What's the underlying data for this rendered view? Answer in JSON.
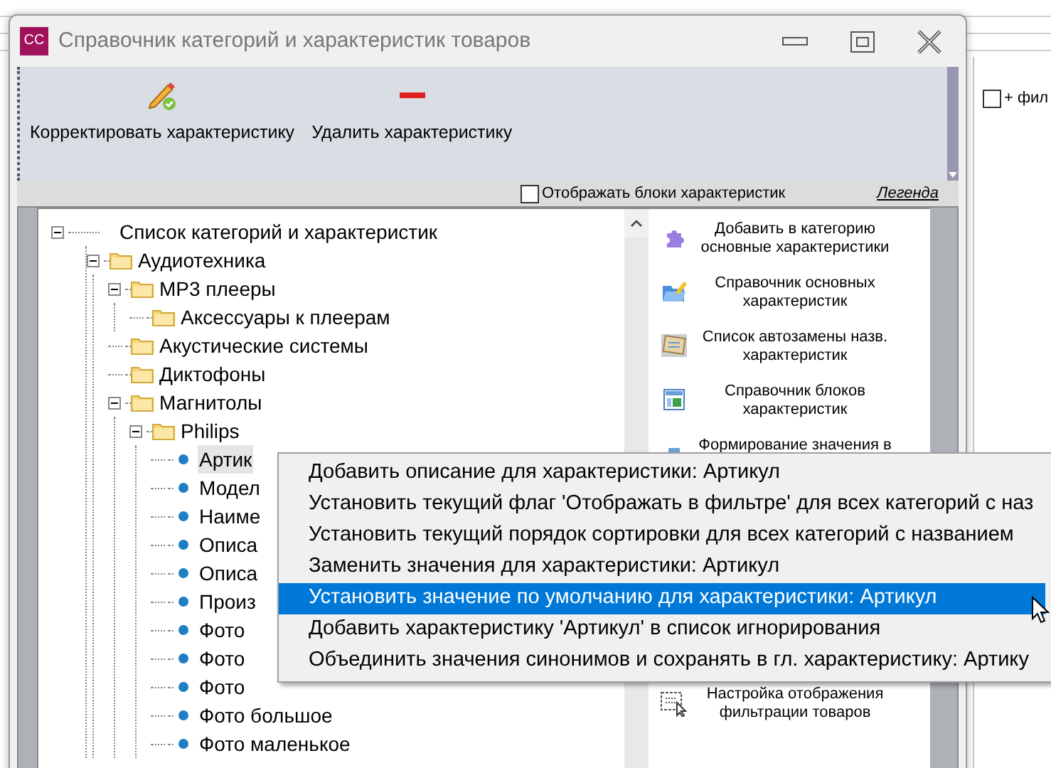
{
  "window": {
    "title": "Справочник категорий и характеристик товаров",
    "logo": "CC"
  },
  "toolbar": [
    {
      "label": "Корректировать характеристику",
      "kind": "edit"
    },
    {
      "label": "Удалить характеристику",
      "kind": "delete"
    }
  ],
  "show_blocks": {
    "label": "Отображать блоки характеристик",
    "checked": false
  },
  "legend_link": "Легенда",
  "tree": {
    "label": "Список категорий и характеристик",
    "kind": "root",
    "expanded": true,
    "selected": false,
    "children": [
      {
        "label": "Аудиотехника",
        "kind": "folder",
        "expanded": true,
        "selected": false,
        "children": [
          {
            "label": "MP3 плееры",
            "kind": "folder",
            "expanded": true,
            "selected": false,
            "children": [
              {
                "label": "Аксессуары к плеерам",
                "kind": "folder",
                "selected": false
              }
            ]
          },
          {
            "label": "Акустические системы",
            "kind": "folder",
            "selected": false
          },
          {
            "label": "Диктофоны",
            "kind": "folder",
            "selected": false
          },
          {
            "label": "Магнитолы",
            "kind": "folder",
            "expanded": true,
            "selected": false,
            "children": [
              {
                "label": "Philips",
                "kind": "folder",
                "expanded": true,
                "selected": false,
                "children": [
                  {
                    "label": "Артик",
                    "kind": "property",
                    "selected": true
                  },
                  {
                    "label": "Модел",
                    "kind": "property",
                    "selected": false
                  },
                  {
                    "label": "Наиме",
                    "kind": "property",
                    "selected": false
                  },
                  {
                    "label": "Описа",
                    "kind": "property",
                    "selected": false
                  },
                  {
                    "label": "Описа",
                    "kind": "property",
                    "selected": false
                  },
                  {
                    "label": "Произ",
                    "kind": "property",
                    "selected": false
                  },
                  {
                    "label": "Фото",
                    "kind": "property",
                    "selected": false
                  },
                  {
                    "label": "Фото",
                    "kind": "property",
                    "selected": false
                  },
                  {
                    "label": "Фото",
                    "kind": "property",
                    "selected": false
                  },
                  {
                    "label": "Фото большое",
                    "kind": "property",
                    "selected": false
                  },
                  {
                    "label": "Фото маленькое",
                    "kind": "property",
                    "selected": false
                  }
                ]
              }
            ]
          }
        ]
      }
    ]
  },
  "actions": [
    {
      "label": "Добавить в категорию основные характеристики",
      "kind": "puzzle"
    },
    {
      "label": "Справочник основных характеристик",
      "kind": "folder-edit"
    },
    {
      "label": "Список автозамены назв. характеристик",
      "kind": "notepad"
    },
    {
      "label": "Справочник блоков характеристик",
      "kind": "blocks"
    },
    {
      "label": "Формирование значения в",
      "kind": "form"
    },
    {
      "label": "Настройка отображения фильтрации товаров",
      "kind": "filter"
    }
  ],
  "context_menu": [
    {
      "label": "Добавить описание для характеристики: Артикул",
      "selected": false
    },
    {
      "label": "Установить текущий флаг 'Отображать в фильтре' для всех категорий с наз",
      "selected": false
    },
    {
      "label": "Установить текущий порядок сортировки для всех категорий с названием",
      "selected": false
    },
    {
      "label": "Заменить значения для характеристики: Артикул",
      "selected": false
    },
    {
      "label": "Установить значение по умолчанию для характеристики: Артикул",
      "selected": true
    },
    {
      "label": "Добавить характеристику 'Артикул' в список игнорирования",
      "selected": false
    },
    {
      "label": "Объединить значения синонимов и сохранять в гл. характеристику: Артику",
      "selected": false
    }
  ],
  "background": {
    "checkbox": {
      "label": "+ фил",
      "checked": false
    }
  }
}
